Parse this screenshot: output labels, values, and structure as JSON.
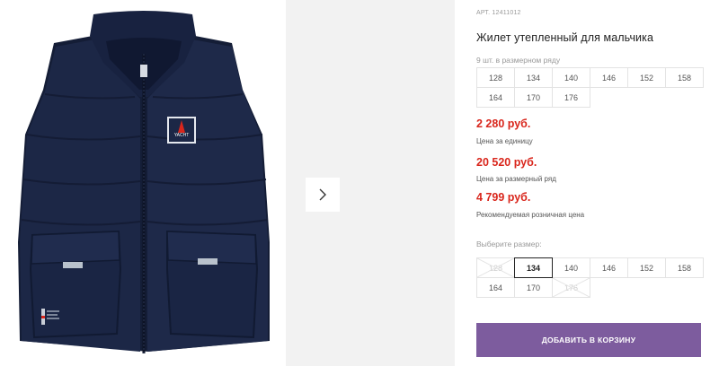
{
  "product": {
    "sku": "АРТ. 12411012",
    "title": "Жилет утепленный для мальчика",
    "pack_label": "9 шт. в размерном ряду",
    "pack_sizes": [
      "128",
      "134",
      "140",
      "146",
      "152",
      "158",
      "164",
      "170",
      "176"
    ],
    "prices": [
      {
        "value": "2 280 руб.",
        "caption": "Цена за единицу"
      },
      {
        "value": "20 520 руб.",
        "caption": "Цена за размерный ряд"
      },
      {
        "value": "4 799 руб.",
        "caption": "Рекомендуемая розничная цена"
      }
    ],
    "choose_label": "Выберите размер:",
    "select_sizes": [
      {
        "label": "128",
        "state": "disabled"
      },
      {
        "label": "134",
        "state": "selected"
      },
      {
        "label": "140",
        "state": "available"
      },
      {
        "label": "146",
        "state": "available"
      },
      {
        "label": "152",
        "state": "available"
      },
      {
        "label": "158",
        "state": "available"
      },
      {
        "label": "164",
        "state": "available"
      },
      {
        "label": "170",
        "state": "available"
      },
      {
        "label": "176",
        "state": "disabled"
      }
    ],
    "add_to_cart": "ДОБАВИТЬ В КОРЗИНУ",
    "badge_text": "YACHT"
  },
  "colors": {
    "price": "#d9261c",
    "button": "#7d5c9e",
    "vest": "#1c2746"
  },
  "icons": {
    "next": "chevron-right-icon",
    "disabled": "cross-out-icon"
  }
}
